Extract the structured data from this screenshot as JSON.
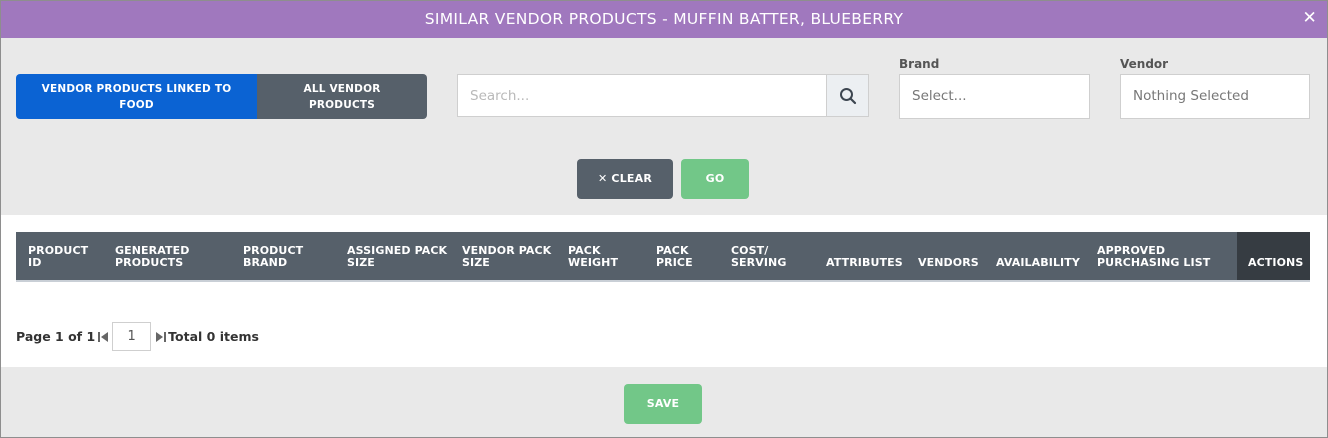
{
  "dialog": {
    "title": "SIMILAR VENDOR PRODUCTS -  MUFFIN BATTER, BLUEBERRY",
    "close_glyph": "✕"
  },
  "toggle": {
    "linked_label": "VENDOR PRODUCTS LINKED TO FOOD",
    "all_label": "ALL VENDOR PRODUCTS",
    "active": "linked"
  },
  "search": {
    "placeholder": "Search...",
    "value": ""
  },
  "brand": {
    "label": "Brand",
    "value": "Select..."
  },
  "vendor": {
    "label": "Vendor",
    "value": "Nothing Selected"
  },
  "buttons": {
    "clear_label": "✕ CLEAR",
    "go_label": "GO",
    "save_label": "SAVE"
  },
  "table": {
    "columns": [
      "PRODUCT ID",
      "GENERATED PRODUCTS",
      "PRODUCT BRAND",
      "ASSIGNED PACK SIZE",
      "VENDOR PACK SIZE",
      "PACK WEIGHT",
      "PACK PRICE",
      "COST/ SERVING",
      "ATTRIBUTES",
      "VENDORS",
      "AVAILABILITY",
      "APPROVED PURCHASING LIST",
      "ACTIONS"
    ],
    "rows": []
  },
  "pager": {
    "page_text": "Page 1 of 1",
    "current_page": "1",
    "total_text": "Total 0 items"
  },
  "colors": {
    "titlebar": "#a078be",
    "primary": "#0b63d3",
    "dark": "#56606a",
    "success": "#72c788"
  }
}
